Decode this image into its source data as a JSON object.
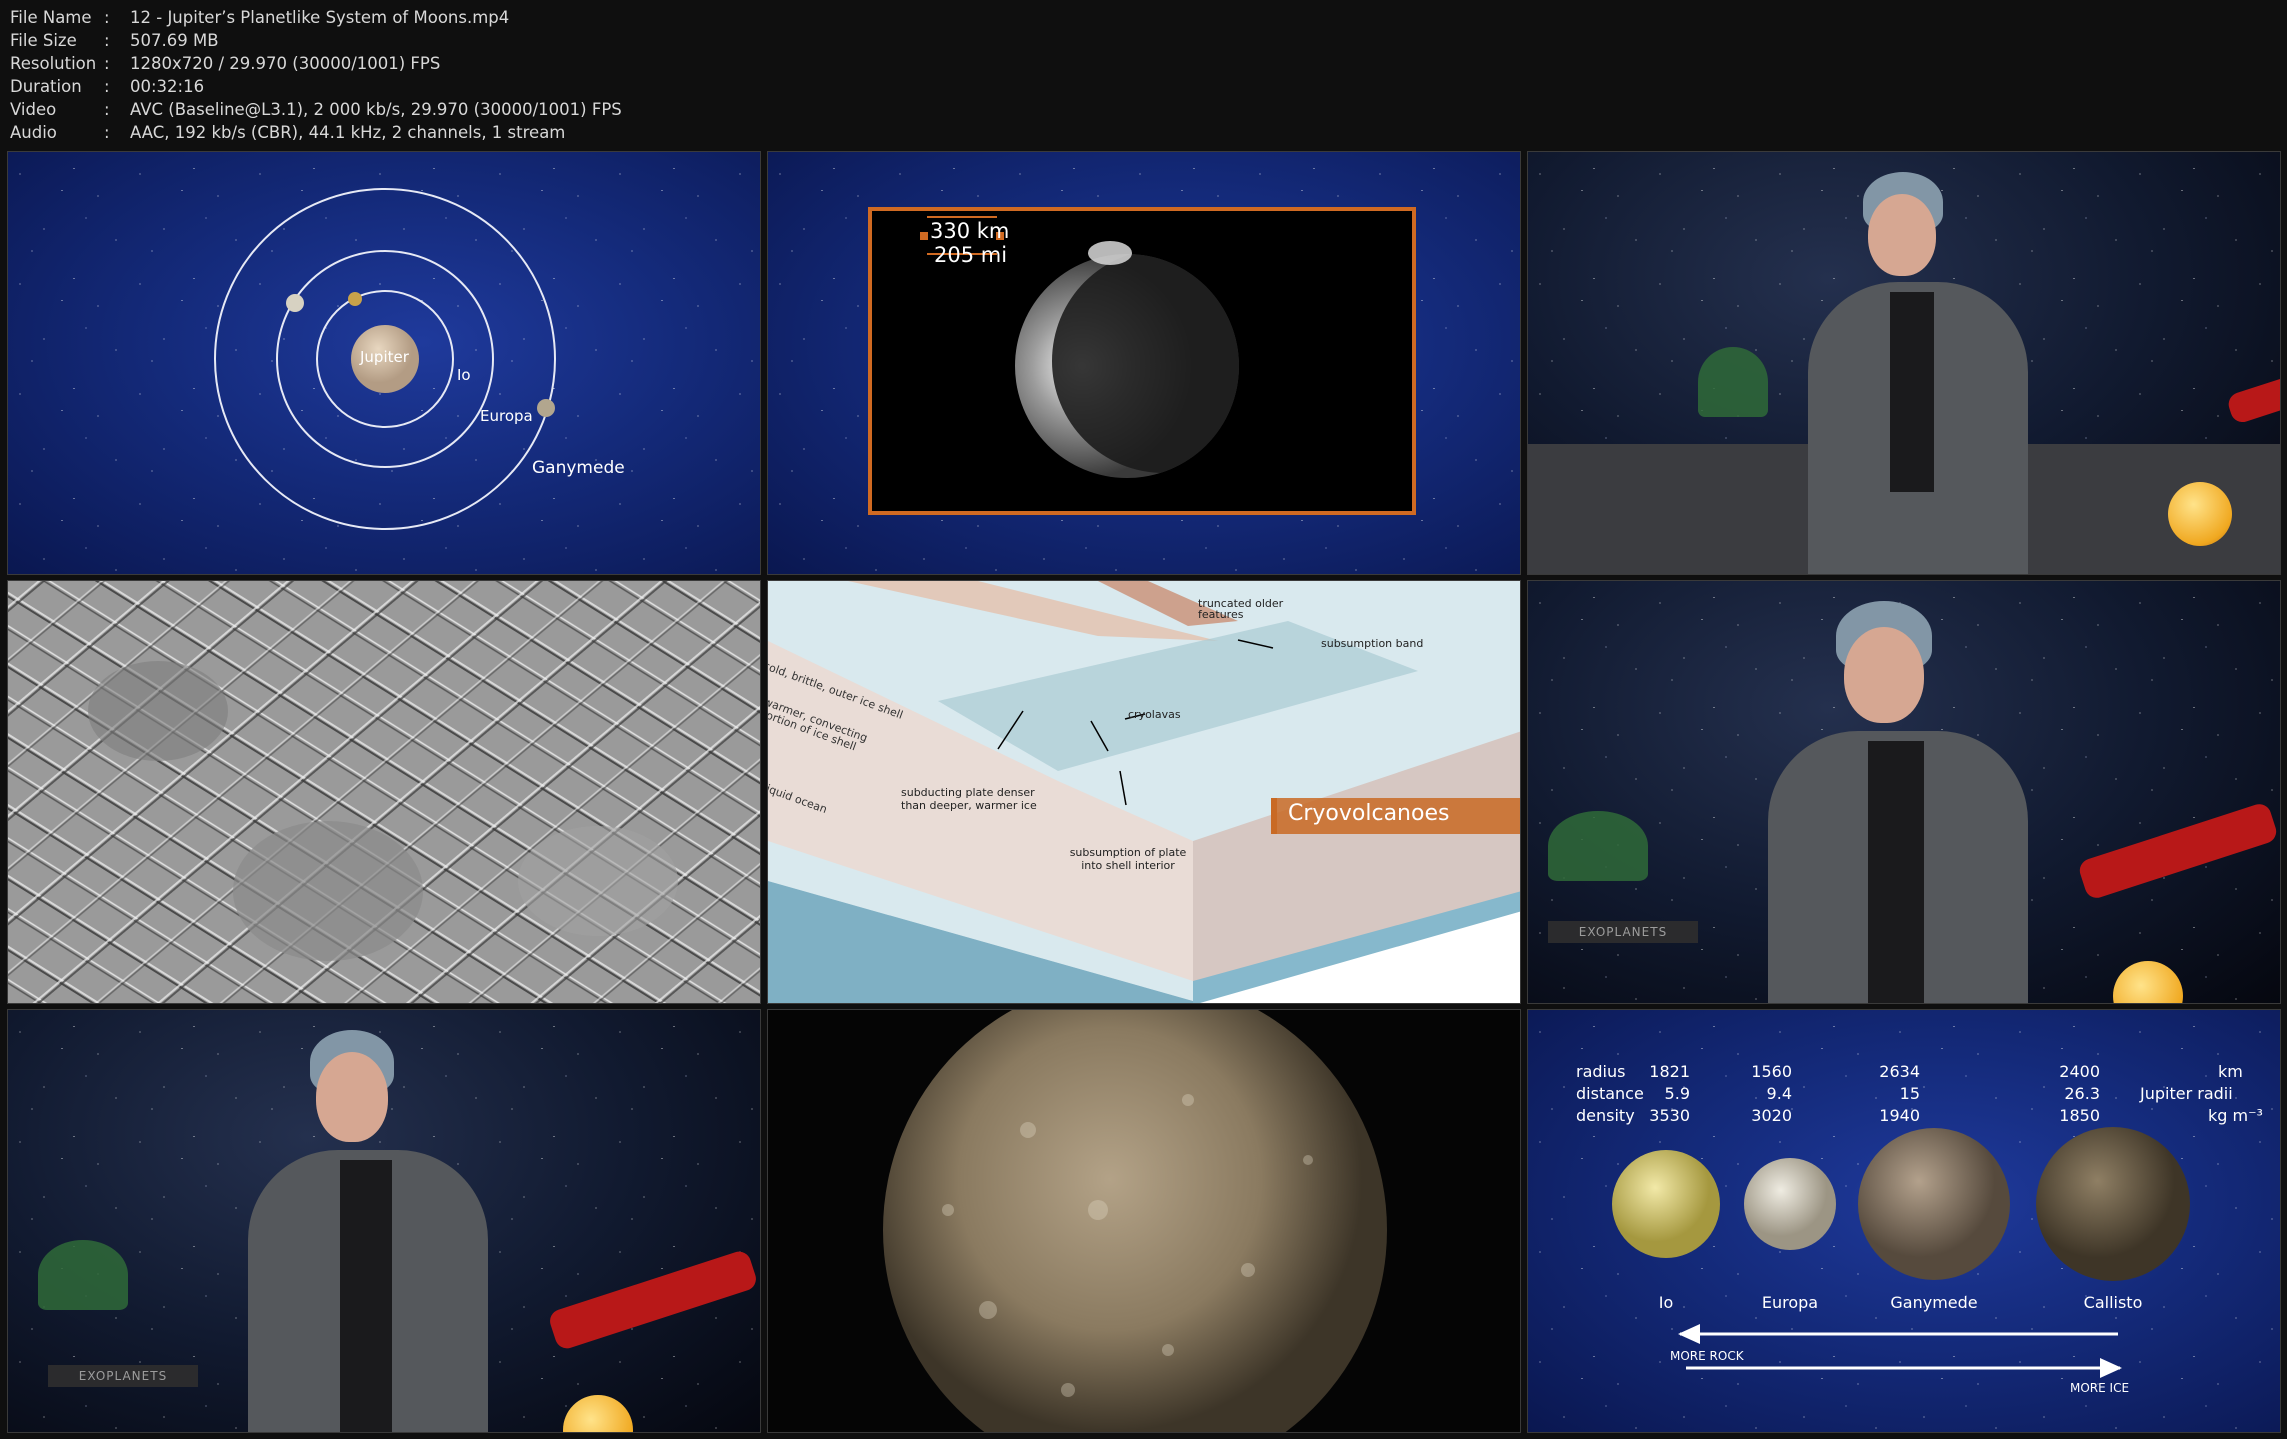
{
  "info": {
    "rows": [
      {
        "key": "File Name",
        "value": "12 - Jupiter’s Planetlike System of Moons.mp4"
      },
      {
        "key": "File Size",
        "value": "507.69 MB"
      },
      {
        "key": "Resolution",
        "value": "1280x720 / 29.970 (30000/1001) FPS"
      },
      {
        "key": "Duration",
        "value": "00:32:16"
      },
      {
        "key": "Video",
        "value": "AVC (Baseline@L3.1), 2 000 kb/s, 29.970 (30000/1001) FPS"
      },
      {
        "key": "Audio",
        "value": "AAC, 192 kb/s (CBR), 44.1 kHz, 2 channels, 1 stream"
      }
    ],
    "separator": ":"
  },
  "frame1": {
    "jupiter": "Jupiter",
    "io": "Io",
    "europa": "Europa",
    "ganymede": "Ganymede"
  },
  "frame2": {
    "km": "330 km",
    "mi": "205 mi"
  },
  "frame5": {
    "truncated": "truncated older features",
    "subsumption_band": "subsumption band",
    "outer_shell": "cold, brittle, outer ice shell",
    "warmer_shell": "warmer, convecting portion of ice shell",
    "liquid_ocean": "liquid ocean",
    "cryolavas": "cryolavas",
    "subducting": "subducting plate denser than deeper, warmer ice",
    "subsumption_plate": "subsumption of plate into shell interior",
    "title": "Cryovolcanoes"
  },
  "frame9": {
    "row_labels": [
      "radius",
      "distance",
      "density"
    ],
    "units": [
      "km",
      "Jupiter radii",
      "kg m⁻³"
    ],
    "moons": [
      {
        "name": "Io",
        "radius": "1821",
        "distance": "5.9",
        "density": "3530",
        "color": "#d9cf7a"
      },
      {
        "name": "Europa",
        "radius": "1560",
        "distance": "9.4",
        "density": "3020",
        "color": "#cfc7b4"
      },
      {
        "name": "Ganymede",
        "radius": "2634",
        "distance": "15",
        "density": "1940",
        "color": "#8a7866"
      },
      {
        "name": "Callisto",
        "radius": "2400",
        "distance": "26.3",
        "density": "1850",
        "color": "#6e5f48"
      }
    ],
    "more_rock": "MORE ROCK",
    "more_ice": "MORE ICE"
  },
  "exoplanets_book": "EXOPLANETS"
}
